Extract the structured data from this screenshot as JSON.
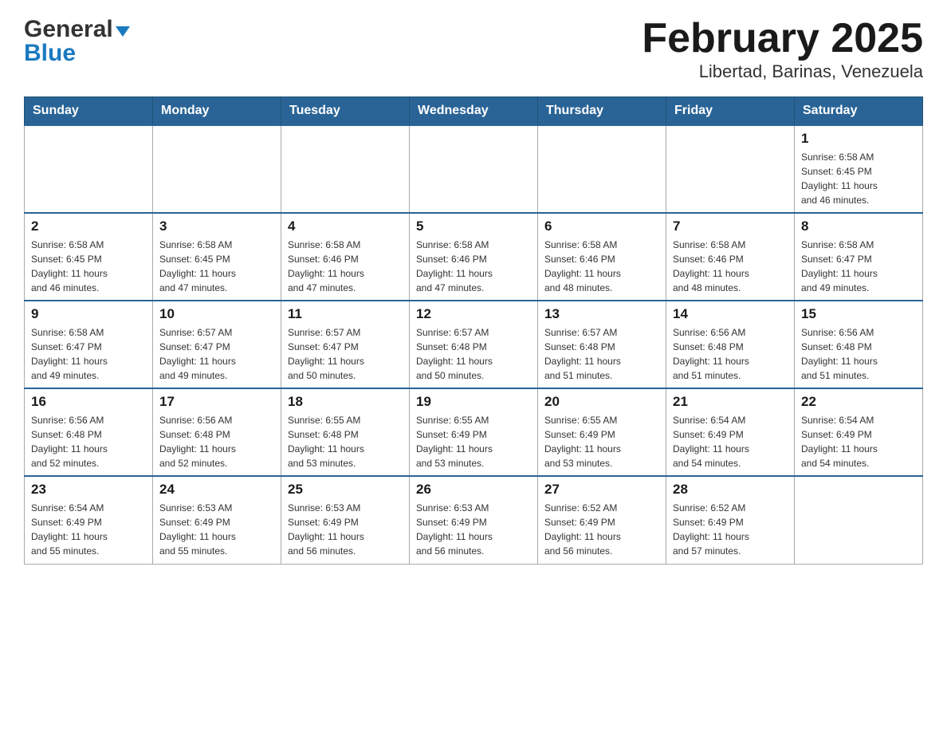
{
  "logo": {
    "part1": "General",
    "part2": "Blue"
  },
  "title": "February 2025",
  "subtitle": "Libertad, Barinas, Venezuela",
  "days_of_week": [
    "Sunday",
    "Monday",
    "Tuesday",
    "Wednesday",
    "Thursday",
    "Friday",
    "Saturday"
  ],
  "weeks": [
    [
      {
        "day": "",
        "info": ""
      },
      {
        "day": "",
        "info": ""
      },
      {
        "day": "",
        "info": ""
      },
      {
        "day": "",
        "info": ""
      },
      {
        "day": "",
        "info": ""
      },
      {
        "day": "",
        "info": ""
      },
      {
        "day": "1",
        "info": "Sunrise: 6:58 AM\nSunset: 6:45 PM\nDaylight: 11 hours\nand 46 minutes."
      }
    ],
    [
      {
        "day": "2",
        "info": "Sunrise: 6:58 AM\nSunset: 6:45 PM\nDaylight: 11 hours\nand 46 minutes."
      },
      {
        "day": "3",
        "info": "Sunrise: 6:58 AM\nSunset: 6:45 PM\nDaylight: 11 hours\nand 47 minutes."
      },
      {
        "day": "4",
        "info": "Sunrise: 6:58 AM\nSunset: 6:46 PM\nDaylight: 11 hours\nand 47 minutes."
      },
      {
        "day": "5",
        "info": "Sunrise: 6:58 AM\nSunset: 6:46 PM\nDaylight: 11 hours\nand 47 minutes."
      },
      {
        "day": "6",
        "info": "Sunrise: 6:58 AM\nSunset: 6:46 PM\nDaylight: 11 hours\nand 48 minutes."
      },
      {
        "day": "7",
        "info": "Sunrise: 6:58 AM\nSunset: 6:46 PM\nDaylight: 11 hours\nand 48 minutes."
      },
      {
        "day": "8",
        "info": "Sunrise: 6:58 AM\nSunset: 6:47 PM\nDaylight: 11 hours\nand 49 minutes."
      }
    ],
    [
      {
        "day": "9",
        "info": "Sunrise: 6:58 AM\nSunset: 6:47 PM\nDaylight: 11 hours\nand 49 minutes."
      },
      {
        "day": "10",
        "info": "Sunrise: 6:57 AM\nSunset: 6:47 PM\nDaylight: 11 hours\nand 49 minutes."
      },
      {
        "day": "11",
        "info": "Sunrise: 6:57 AM\nSunset: 6:47 PM\nDaylight: 11 hours\nand 50 minutes."
      },
      {
        "day": "12",
        "info": "Sunrise: 6:57 AM\nSunset: 6:48 PM\nDaylight: 11 hours\nand 50 minutes."
      },
      {
        "day": "13",
        "info": "Sunrise: 6:57 AM\nSunset: 6:48 PM\nDaylight: 11 hours\nand 51 minutes."
      },
      {
        "day": "14",
        "info": "Sunrise: 6:56 AM\nSunset: 6:48 PM\nDaylight: 11 hours\nand 51 minutes."
      },
      {
        "day": "15",
        "info": "Sunrise: 6:56 AM\nSunset: 6:48 PM\nDaylight: 11 hours\nand 51 minutes."
      }
    ],
    [
      {
        "day": "16",
        "info": "Sunrise: 6:56 AM\nSunset: 6:48 PM\nDaylight: 11 hours\nand 52 minutes."
      },
      {
        "day": "17",
        "info": "Sunrise: 6:56 AM\nSunset: 6:48 PM\nDaylight: 11 hours\nand 52 minutes."
      },
      {
        "day": "18",
        "info": "Sunrise: 6:55 AM\nSunset: 6:48 PM\nDaylight: 11 hours\nand 53 minutes."
      },
      {
        "day": "19",
        "info": "Sunrise: 6:55 AM\nSunset: 6:49 PM\nDaylight: 11 hours\nand 53 minutes."
      },
      {
        "day": "20",
        "info": "Sunrise: 6:55 AM\nSunset: 6:49 PM\nDaylight: 11 hours\nand 53 minutes."
      },
      {
        "day": "21",
        "info": "Sunrise: 6:54 AM\nSunset: 6:49 PM\nDaylight: 11 hours\nand 54 minutes."
      },
      {
        "day": "22",
        "info": "Sunrise: 6:54 AM\nSunset: 6:49 PM\nDaylight: 11 hours\nand 54 minutes."
      }
    ],
    [
      {
        "day": "23",
        "info": "Sunrise: 6:54 AM\nSunset: 6:49 PM\nDaylight: 11 hours\nand 55 minutes."
      },
      {
        "day": "24",
        "info": "Sunrise: 6:53 AM\nSunset: 6:49 PM\nDaylight: 11 hours\nand 55 minutes."
      },
      {
        "day": "25",
        "info": "Sunrise: 6:53 AM\nSunset: 6:49 PM\nDaylight: 11 hours\nand 56 minutes."
      },
      {
        "day": "26",
        "info": "Sunrise: 6:53 AM\nSunset: 6:49 PM\nDaylight: 11 hours\nand 56 minutes."
      },
      {
        "day": "27",
        "info": "Sunrise: 6:52 AM\nSunset: 6:49 PM\nDaylight: 11 hours\nand 56 minutes."
      },
      {
        "day": "28",
        "info": "Sunrise: 6:52 AM\nSunset: 6:49 PM\nDaylight: 11 hours\nand 57 minutes."
      },
      {
        "day": "",
        "info": ""
      }
    ]
  ]
}
